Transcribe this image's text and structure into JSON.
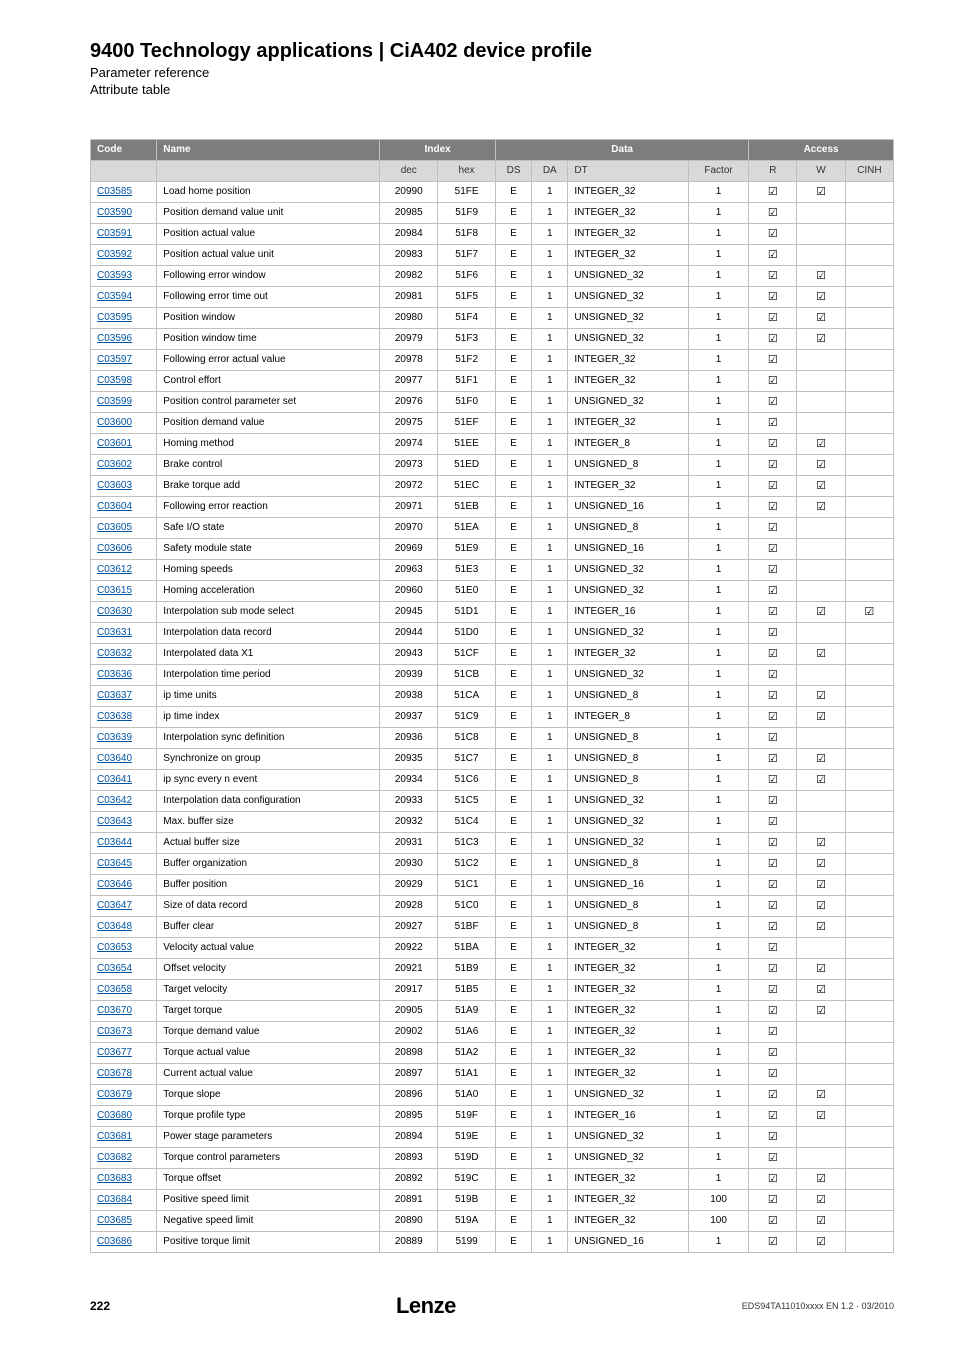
{
  "header": {
    "title": "9400 Technology applications | CiA402 device profile",
    "sub1": "Parameter reference",
    "sub2": "Attribute table"
  },
  "columns": {
    "code": "Code",
    "name": "Name",
    "index": "Index",
    "data": "Data",
    "access": "Access",
    "dec": "dec",
    "hex": "hex",
    "ds": "DS",
    "da": "DA",
    "dt": "DT",
    "factor": "Factor",
    "r": "R",
    "w": "W",
    "cinh": "CINH"
  },
  "rows": [
    {
      "code": "C03585",
      "name": "Load home position",
      "dec": "20990",
      "hex": "51FE",
      "ds": "E",
      "da": "1",
      "dt": "INTEGER_32",
      "factor": "1",
      "r": true,
      "w": true,
      "cinh": false
    },
    {
      "code": "C03590",
      "name": "Position demand value unit",
      "dec": "20985",
      "hex": "51F9",
      "ds": "E",
      "da": "1",
      "dt": "INTEGER_32",
      "factor": "1",
      "r": true,
      "w": false,
      "cinh": false
    },
    {
      "code": "C03591",
      "name": "Position actual value",
      "dec": "20984",
      "hex": "51F8",
      "ds": "E",
      "da": "1",
      "dt": "INTEGER_32",
      "factor": "1",
      "r": true,
      "w": false,
      "cinh": false
    },
    {
      "code": "C03592",
      "name": "Position actual value unit",
      "dec": "20983",
      "hex": "51F7",
      "ds": "E",
      "da": "1",
      "dt": "INTEGER_32",
      "factor": "1",
      "r": true,
      "w": false,
      "cinh": false
    },
    {
      "code": "C03593",
      "name": "Following error window",
      "dec": "20982",
      "hex": "51F6",
      "ds": "E",
      "da": "1",
      "dt": "UNSIGNED_32",
      "factor": "1",
      "r": true,
      "w": true,
      "cinh": false
    },
    {
      "code": "C03594",
      "name": "Following error time out",
      "dec": "20981",
      "hex": "51F5",
      "ds": "E",
      "da": "1",
      "dt": "UNSIGNED_32",
      "factor": "1",
      "r": true,
      "w": true,
      "cinh": false
    },
    {
      "code": "C03595",
      "name": "Position window",
      "dec": "20980",
      "hex": "51F4",
      "ds": "E",
      "da": "1",
      "dt": "UNSIGNED_32",
      "factor": "1",
      "r": true,
      "w": true,
      "cinh": false
    },
    {
      "code": "C03596",
      "name": "Position window time",
      "dec": "20979",
      "hex": "51F3",
      "ds": "E",
      "da": "1",
      "dt": "UNSIGNED_32",
      "factor": "1",
      "r": true,
      "w": true,
      "cinh": false
    },
    {
      "code": "C03597",
      "name": "Following error actual value",
      "dec": "20978",
      "hex": "51F2",
      "ds": "E",
      "da": "1",
      "dt": "INTEGER_32",
      "factor": "1",
      "r": true,
      "w": false,
      "cinh": false
    },
    {
      "code": "C03598",
      "name": "Control effort",
      "dec": "20977",
      "hex": "51F1",
      "ds": "E",
      "da": "1",
      "dt": "INTEGER_32",
      "factor": "1",
      "r": true,
      "w": false,
      "cinh": false
    },
    {
      "code": "C03599",
      "name": "Position control parameter set",
      "dec": "20976",
      "hex": "51F0",
      "ds": "E",
      "da": "1",
      "dt": "UNSIGNED_32",
      "factor": "1",
      "r": true,
      "w": false,
      "cinh": false
    },
    {
      "code": "C03600",
      "name": "Position demand value",
      "dec": "20975",
      "hex": "51EF",
      "ds": "E",
      "da": "1",
      "dt": "INTEGER_32",
      "factor": "1",
      "r": true,
      "w": false,
      "cinh": false
    },
    {
      "code": "C03601",
      "name": "Homing method",
      "dec": "20974",
      "hex": "51EE",
      "ds": "E",
      "da": "1",
      "dt": "INTEGER_8",
      "factor": "1",
      "r": true,
      "w": true,
      "cinh": false
    },
    {
      "code": "C03602",
      "name": "Brake control",
      "dec": "20973",
      "hex": "51ED",
      "ds": "E",
      "da": "1",
      "dt": "UNSIGNED_8",
      "factor": "1",
      "r": true,
      "w": true,
      "cinh": false
    },
    {
      "code": "C03603",
      "name": "Brake torque add",
      "dec": "20972",
      "hex": "51EC",
      "ds": "E",
      "da": "1",
      "dt": "INTEGER_32",
      "factor": "1",
      "r": true,
      "w": true,
      "cinh": false
    },
    {
      "code": "C03604",
      "name": "Following error reaction",
      "dec": "20971",
      "hex": "51EB",
      "ds": "E",
      "da": "1",
      "dt": "UNSIGNED_16",
      "factor": "1",
      "r": true,
      "w": true,
      "cinh": false
    },
    {
      "code": "C03605",
      "name": "Safe I/O state",
      "dec": "20970",
      "hex": "51EA",
      "ds": "E",
      "da": "1",
      "dt": "UNSIGNED_8",
      "factor": "1",
      "r": true,
      "w": false,
      "cinh": false
    },
    {
      "code": "C03606",
      "name": "Safety module state",
      "dec": "20969",
      "hex": "51E9",
      "ds": "E",
      "da": "1",
      "dt": "UNSIGNED_16",
      "factor": "1",
      "r": true,
      "w": false,
      "cinh": false
    },
    {
      "code": "C03612",
      "name": "Homing speeds",
      "dec": "20963",
      "hex": "51E3",
      "ds": "E",
      "da": "1",
      "dt": "UNSIGNED_32",
      "factor": "1",
      "r": true,
      "w": false,
      "cinh": false
    },
    {
      "code": "C03615",
      "name": "Homing acceleration",
      "dec": "20960",
      "hex": "51E0",
      "ds": "E",
      "da": "1",
      "dt": "UNSIGNED_32",
      "factor": "1",
      "r": true,
      "w": false,
      "cinh": false
    },
    {
      "code": "C03630",
      "name": "Interpolation sub mode select",
      "dec": "20945",
      "hex": "51D1",
      "ds": "E",
      "da": "1",
      "dt": "INTEGER_16",
      "factor": "1",
      "r": true,
      "w": true,
      "cinh": true
    },
    {
      "code": "C03631",
      "name": "Interpolation data record",
      "dec": "20944",
      "hex": "51D0",
      "ds": "E",
      "da": "1",
      "dt": "UNSIGNED_32",
      "factor": "1",
      "r": true,
      "w": false,
      "cinh": false
    },
    {
      "code": "C03632",
      "name": "Interpolated data X1",
      "dec": "20943",
      "hex": "51CF",
      "ds": "E",
      "da": "1",
      "dt": "INTEGER_32",
      "factor": "1",
      "r": true,
      "w": true,
      "cinh": false
    },
    {
      "code": "C03636",
      "name": "Interpolation time period",
      "dec": "20939",
      "hex": "51CB",
      "ds": "E",
      "da": "1",
      "dt": "UNSIGNED_32",
      "factor": "1",
      "r": true,
      "w": false,
      "cinh": false
    },
    {
      "code": "C03637",
      "name": "ip time units",
      "dec": "20938",
      "hex": "51CA",
      "ds": "E",
      "da": "1",
      "dt": "UNSIGNED_8",
      "factor": "1",
      "r": true,
      "w": true,
      "cinh": false
    },
    {
      "code": "C03638",
      "name": "ip time index",
      "dec": "20937",
      "hex": "51C9",
      "ds": "E",
      "da": "1",
      "dt": "INTEGER_8",
      "factor": "1",
      "r": true,
      "w": true,
      "cinh": false
    },
    {
      "code": "C03639",
      "name": "Interpolation sync definition",
      "dec": "20936",
      "hex": "51C8",
      "ds": "E",
      "da": "1",
      "dt": "UNSIGNED_8",
      "factor": "1",
      "r": true,
      "w": false,
      "cinh": false
    },
    {
      "code": "C03640",
      "name": "Synchronize on group",
      "dec": "20935",
      "hex": "51C7",
      "ds": "E",
      "da": "1",
      "dt": "UNSIGNED_8",
      "factor": "1",
      "r": true,
      "w": true,
      "cinh": false
    },
    {
      "code": "C03641",
      "name": "ip sync every n event",
      "dec": "20934",
      "hex": "51C6",
      "ds": "E",
      "da": "1",
      "dt": "UNSIGNED_8",
      "factor": "1",
      "r": true,
      "w": true,
      "cinh": false
    },
    {
      "code": "C03642",
      "name": "Interpolation data configuration",
      "dec": "20933",
      "hex": "51C5",
      "ds": "E",
      "da": "1",
      "dt": "UNSIGNED_32",
      "factor": "1",
      "r": true,
      "w": false,
      "cinh": false
    },
    {
      "code": "C03643",
      "name": "Max. buffer size",
      "dec": "20932",
      "hex": "51C4",
      "ds": "E",
      "da": "1",
      "dt": "UNSIGNED_32",
      "factor": "1",
      "r": true,
      "w": false,
      "cinh": false
    },
    {
      "code": "C03644",
      "name": "Actual buffer size",
      "dec": "20931",
      "hex": "51C3",
      "ds": "E",
      "da": "1",
      "dt": "UNSIGNED_32",
      "factor": "1",
      "r": true,
      "w": true,
      "cinh": false
    },
    {
      "code": "C03645",
      "name": "Buffer organization",
      "dec": "20930",
      "hex": "51C2",
      "ds": "E",
      "da": "1",
      "dt": "UNSIGNED_8",
      "factor": "1",
      "r": true,
      "w": true,
      "cinh": false
    },
    {
      "code": "C03646",
      "name": "Buffer position",
      "dec": "20929",
      "hex": "51C1",
      "ds": "E",
      "da": "1",
      "dt": "UNSIGNED_16",
      "factor": "1",
      "r": true,
      "w": true,
      "cinh": false
    },
    {
      "code": "C03647",
      "name": "Size of data record",
      "dec": "20928",
      "hex": "51C0",
      "ds": "E",
      "da": "1",
      "dt": "UNSIGNED_8",
      "factor": "1",
      "r": true,
      "w": true,
      "cinh": false
    },
    {
      "code": "C03648",
      "name": "Buffer clear",
      "dec": "20927",
      "hex": "51BF",
      "ds": "E",
      "da": "1",
      "dt": "UNSIGNED_8",
      "factor": "1",
      "r": true,
      "w": true,
      "cinh": false
    },
    {
      "code": "C03653",
      "name": "Velocity actual value",
      "dec": "20922",
      "hex": "51BA",
      "ds": "E",
      "da": "1",
      "dt": "INTEGER_32",
      "factor": "1",
      "r": true,
      "w": false,
      "cinh": false
    },
    {
      "code": "C03654",
      "name": "Offset velocity",
      "dec": "20921",
      "hex": "51B9",
      "ds": "E",
      "da": "1",
      "dt": "INTEGER_32",
      "factor": "1",
      "r": true,
      "w": true,
      "cinh": false
    },
    {
      "code": "C03658",
      "name": "Target velocity",
      "dec": "20917",
      "hex": "51B5",
      "ds": "E",
      "da": "1",
      "dt": "INTEGER_32",
      "factor": "1",
      "r": true,
      "w": true,
      "cinh": false
    },
    {
      "code": "C03670",
      "name": "Target torque",
      "dec": "20905",
      "hex": "51A9",
      "ds": "E",
      "da": "1",
      "dt": "INTEGER_32",
      "factor": "1",
      "r": true,
      "w": true,
      "cinh": false
    },
    {
      "code": "C03673",
      "name": "Torque demand value",
      "dec": "20902",
      "hex": "51A6",
      "ds": "E",
      "da": "1",
      "dt": "INTEGER_32",
      "factor": "1",
      "r": true,
      "w": false,
      "cinh": false
    },
    {
      "code": "C03677",
      "name": "Torque actual value",
      "dec": "20898",
      "hex": "51A2",
      "ds": "E",
      "da": "1",
      "dt": "INTEGER_32",
      "factor": "1",
      "r": true,
      "w": false,
      "cinh": false
    },
    {
      "code": "C03678",
      "name": "Current actual value",
      "dec": "20897",
      "hex": "51A1",
      "ds": "E",
      "da": "1",
      "dt": "INTEGER_32",
      "factor": "1",
      "r": true,
      "w": false,
      "cinh": false
    },
    {
      "code": "C03679",
      "name": "Torque slope",
      "dec": "20896",
      "hex": "51A0",
      "ds": "E",
      "da": "1",
      "dt": "UNSIGNED_32",
      "factor": "1",
      "r": true,
      "w": true,
      "cinh": false
    },
    {
      "code": "C03680",
      "name": "Torque profile type",
      "dec": "20895",
      "hex": "519F",
      "ds": "E",
      "da": "1",
      "dt": "INTEGER_16",
      "factor": "1",
      "r": true,
      "w": true,
      "cinh": false
    },
    {
      "code": "C03681",
      "name": "Power stage parameters",
      "dec": "20894",
      "hex": "519E",
      "ds": "E",
      "da": "1",
      "dt": "UNSIGNED_32",
      "factor": "1",
      "r": true,
      "w": false,
      "cinh": false
    },
    {
      "code": "C03682",
      "name": "Torque control parameters",
      "dec": "20893",
      "hex": "519D",
      "ds": "E",
      "da": "1",
      "dt": "UNSIGNED_32",
      "factor": "1",
      "r": true,
      "w": false,
      "cinh": false
    },
    {
      "code": "C03683",
      "name": "Torque offset",
      "dec": "20892",
      "hex": "519C",
      "ds": "E",
      "da": "1",
      "dt": "INTEGER_32",
      "factor": "1",
      "r": true,
      "w": true,
      "cinh": false
    },
    {
      "code": "C03684",
      "name": "Positive speed limit",
      "dec": "20891",
      "hex": "519B",
      "ds": "E",
      "da": "1",
      "dt": "INTEGER_32",
      "factor": "100",
      "r": true,
      "w": true,
      "cinh": false
    },
    {
      "code": "C03685",
      "name": "Negative speed limit",
      "dec": "20890",
      "hex": "519A",
      "ds": "E",
      "da": "1",
      "dt": "INTEGER_32",
      "factor": "100",
      "r": true,
      "w": true,
      "cinh": false
    },
    {
      "code": "C03686",
      "name": "Positive torque limit",
      "dec": "20889",
      "hex": "5199",
      "ds": "E",
      "da": "1",
      "dt": "UNSIGNED_16",
      "factor": "1",
      "r": true,
      "w": true,
      "cinh": false
    }
  ],
  "footer": {
    "page": "222",
    "brand": "Lenze",
    "docinfo": "EDS94TA11010xxxx EN 1.2 · 03/2010"
  }
}
